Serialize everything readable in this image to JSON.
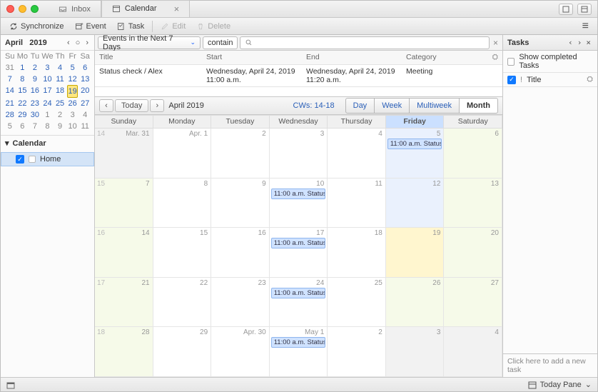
{
  "tabs": {
    "inbox": "Inbox",
    "calendar": "Calendar"
  },
  "toolbar": {
    "synchronize": "Synchronize",
    "event": "Event",
    "task": "Task",
    "edit": "Edit",
    "delete": "Delete"
  },
  "miniCal": {
    "month": "April",
    "year": "2019",
    "dow": [
      "Su",
      "Mo",
      "Tu",
      "We",
      "Th",
      "Fr",
      "Sa"
    ],
    "days": [
      {
        "n": "31",
        "cm": false
      },
      {
        "n": "1",
        "cm": true
      },
      {
        "n": "2",
        "cm": true
      },
      {
        "n": "3",
        "cm": true
      },
      {
        "n": "4",
        "cm": true
      },
      {
        "n": "5",
        "cm": true
      },
      {
        "n": "6",
        "cm": true
      },
      {
        "n": "7",
        "cm": true
      },
      {
        "n": "8",
        "cm": true
      },
      {
        "n": "9",
        "cm": true
      },
      {
        "n": "10",
        "cm": true
      },
      {
        "n": "11",
        "cm": true
      },
      {
        "n": "12",
        "cm": true
      },
      {
        "n": "13",
        "cm": true
      },
      {
        "n": "14",
        "cm": true
      },
      {
        "n": "15",
        "cm": true
      },
      {
        "n": "16",
        "cm": true
      },
      {
        "n": "17",
        "cm": true
      },
      {
        "n": "18",
        "cm": true
      },
      {
        "n": "19",
        "cm": true,
        "today": true
      },
      {
        "n": "20",
        "cm": true
      },
      {
        "n": "21",
        "cm": true
      },
      {
        "n": "22",
        "cm": true
      },
      {
        "n": "23",
        "cm": true
      },
      {
        "n": "24",
        "cm": true
      },
      {
        "n": "25",
        "cm": true
      },
      {
        "n": "26",
        "cm": true
      },
      {
        "n": "27",
        "cm": true
      },
      {
        "n": "28",
        "cm": true
      },
      {
        "n": "29",
        "cm": true
      },
      {
        "n": "30",
        "cm": true
      },
      {
        "n": "1",
        "cm": false
      },
      {
        "n": "2",
        "cm": false
      },
      {
        "n": "3",
        "cm": false
      },
      {
        "n": "4",
        "cm": false
      },
      {
        "n": "5",
        "cm": false
      },
      {
        "n": "6",
        "cm": false
      },
      {
        "n": "7",
        "cm": false
      },
      {
        "n": "8",
        "cm": false
      },
      {
        "n": "9",
        "cm": false
      },
      {
        "n": "10",
        "cm": false
      },
      {
        "n": "11",
        "cm": false
      }
    ]
  },
  "sidebar": {
    "heading": "Calendar",
    "item": "Home"
  },
  "filter": {
    "range": "Events in the Next 7 Days",
    "op": "contain",
    "search_ph": ""
  },
  "listHead": {
    "title": "Title",
    "start": "Start",
    "end": "End",
    "category": "Category"
  },
  "listRows": [
    {
      "title": "Status check / Alex",
      "start": "Wednesday, April 24, 2019 11:00 a.m.",
      "end": "Wednesday, April 24, 2019 11:20 a.m.",
      "category": "Meeting"
    }
  ],
  "calbar": {
    "today": "Today",
    "title": "April 2019",
    "cw": "CWs: 14-18",
    "views": [
      "Day",
      "Week",
      "Multiweek",
      "Month"
    ],
    "selected": "Month"
  },
  "gridHead": [
    "Sunday",
    "Monday",
    "Tuesday",
    "Wednesday",
    "Thursday",
    "Friday",
    "Saturday"
  ],
  "gridHighlight": "Friday",
  "weeks": [
    {
      "wk": "14",
      "cells": [
        {
          "d": "Mar. 31",
          "cls": "other"
        },
        {
          "d": "Apr. 1"
        },
        {
          "d": "2"
        },
        {
          "d": "3"
        },
        {
          "d": "4"
        },
        {
          "d": "5",
          "cls": "past-fri",
          "ev": "11:00 a.m. Status ..."
        },
        {
          "d": "6",
          "cls": "wknd"
        }
      ]
    },
    {
      "wk": "15",
      "cells": [
        {
          "d": "7",
          "cls": "wknd"
        },
        {
          "d": "8"
        },
        {
          "d": "9"
        },
        {
          "d": "10",
          "ev": "11:00 a.m. Status ..."
        },
        {
          "d": "11"
        },
        {
          "d": "12",
          "cls": "past-fri"
        },
        {
          "d": "13",
          "cls": "wknd"
        }
      ]
    },
    {
      "wk": "16",
      "cells": [
        {
          "d": "14",
          "cls": "wknd"
        },
        {
          "d": "15"
        },
        {
          "d": "16"
        },
        {
          "d": "17",
          "ev": "11:00 a.m. Status ..."
        },
        {
          "d": "18"
        },
        {
          "d": "19",
          "cls": "today"
        },
        {
          "d": "20",
          "cls": "wknd"
        }
      ]
    },
    {
      "wk": "17",
      "cells": [
        {
          "d": "21",
          "cls": "wknd"
        },
        {
          "d": "22"
        },
        {
          "d": "23"
        },
        {
          "d": "24",
          "ev": "11:00 a.m. Status ..."
        },
        {
          "d": "25"
        },
        {
          "d": "26",
          "cls": "wknd"
        },
        {
          "d": "27",
          "cls": "wknd"
        }
      ]
    },
    {
      "wk": "18",
      "cells": [
        {
          "d": "28",
          "cls": "wknd"
        },
        {
          "d": "29"
        },
        {
          "d": "Apr. 30"
        },
        {
          "d": "May 1",
          "ev": "11:00 a.m. Status ..."
        },
        {
          "d": "2"
        },
        {
          "d": "3",
          "cls": "other"
        },
        {
          "d": "4",
          "cls": "other"
        }
      ]
    }
  ],
  "tasks": {
    "heading": "Tasks",
    "showCompleted": "Show completed Tasks",
    "titleCol": "Title",
    "footer": "Click here to add a new task"
  },
  "status": {
    "todayPane": "Today Pane"
  }
}
